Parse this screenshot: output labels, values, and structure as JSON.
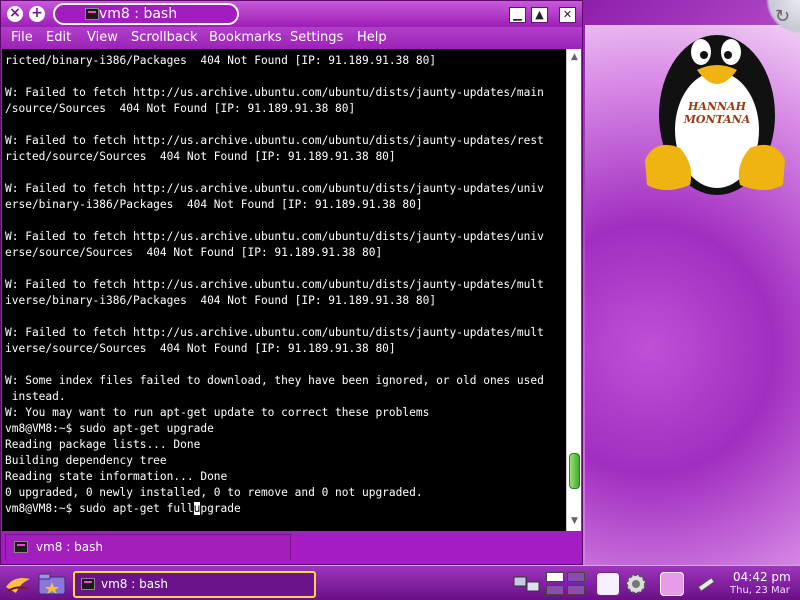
{
  "window": {
    "title": "vm8 : bash",
    "buttons": {
      "close": "×",
      "new": "+"
    },
    "wm_controls": {
      "minimize": "▁",
      "maximize": "▲",
      "close": "✕"
    }
  },
  "menubar": {
    "items": [
      "File",
      "Edit",
      "View",
      "Scrollback",
      "Bookmarks",
      "Settings",
      "Help"
    ]
  },
  "terminal": {
    "lines": [
      "ricted/binary-i386/Packages  404 Not Found [IP: 91.189.91.38 80]",
      "",
      "W: Failed to fetch http://us.archive.ubuntu.com/ubuntu/dists/jaunty-updates/main",
      "/source/Sources  404 Not Found [IP: 91.189.91.38 80]",
      "",
      "W: Failed to fetch http://us.archive.ubuntu.com/ubuntu/dists/jaunty-updates/rest",
      "ricted/source/Sources  404 Not Found [IP: 91.189.91.38 80]",
      "",
      "W: Failed to fetch http://us.archive.ubuntu.com/ubuntu/dists/jaunty-updates/univ",
      "erse/binary-i386/Packages  404 Not Found [IP: 91.189.91.38 80]",
      "",
      "W: Failed to fetch http://us.archive.ubuntu.com/ubuntu/dists/jaunty-updates/univ",
      "erse/source/Sources  404 Not Found [IP: 91.189.91.38 80]",
      "",
      "W: Failed to fetch http://us.archive.ubuntu.com/ubuntu/dists/jaunty-updates/mult",
      "iverse/binary-i386/Packages  404 Not Found [IP: 91.189.91.38 80]",
      "",
      "W: Failed to fetch http://us.archive.ubuntu.com/ubuntu/dists/jaunty-updates/mult",
      "iverse/source/Sources  404 Not Found [IP: 91.189.91.38 80]",
      "",
      "W: Some index files failed to download, they have been ignored, or old ones used",
      " instead.",
      "W: You may want to run apt-get update to correct these problems",
      "vm8@VM8:~$ sudo apt-get upgrade",
      "Reading package lists... Done",
      "Building dependency tree",
      "Reading state information... Done",
      "0 upgraded, 0 newly installed, 0 to remove and 0 not upgraded."
    ],
    "prompt_before_cursor": "vm8@VM8:~$ sudo apt-get full",
    "cursor_char": "u",
    "prompt_after_cursor": "pgrade"
  },
  "scrollbar": {
    "up": "▲",
    "down": "▼",
    "position": 0.93
  },
  "tabbar": {
    "tab_label": "vm8 : bash"
  },
  "taskbar": {
    "task_label": "vm8 : bash",
    "clock_time": "04:42 pm",
    "clock_date": "Thu, 23 Mar"
  },
  "desktop": {
    "corner_arrow": "↻",
    "penguin_badge_line1": "HANNAH",
    "penguin_badge_line2": "MONTANA"
  },
  "colors": {
    "accent": "#a51cc4",
    "terminal_bg": "#000000",
    "terminal_fg": "#ffffff",
    "scroll_thumb": "#3fae2a",
    "task_highlight": "#ffd24a"
  }
}
